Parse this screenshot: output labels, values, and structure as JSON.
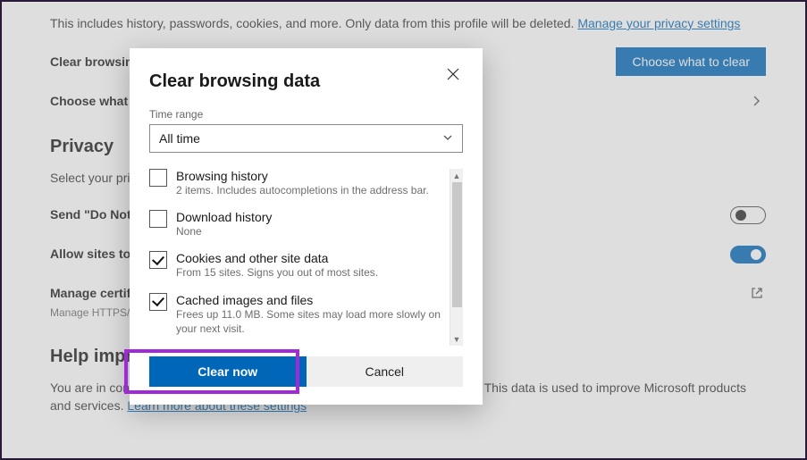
{
  "page": {
    "intro_text": "This includes history, passwords, cookies, and more. Only data from this profile will be deleted. ",
    "intro_link": "Manage your privacy settings",
    "row_clear_label": "Clear browsing data",
    "btn_choose": "Choose what to clear",
    "row_choose_close": "Choose what to clear every time you close the browser",
    "section_privacy": "Privacy",
    "privacy_sub": "Select your privacy settings for Microsoft Edge.",
    "row_dnt": "Send \"Do Not Track\" requests",
    "row_allow_sites": "Allow sites to check if you have payment methods saved",
    "row_certs": "Manage certificates",
    "row_certs_desc": "Manage HTTPS/SSL certificates and settings",
    "section_help": "Help improve Microsoft Edge",
    "help_text_a": "You are in control of your data. Learn about the data you share with Microsoft. This data is used to improve Microsoft products and services. ",
    "help_link": "Learn more about these settings"
  },
  "dialog": {
    "title": "Clear browsing data",
    "time_label": "Time range",
    "time_value": "All time",
    "options": [
      {
        "title": "Browsing history",
        "desc": "2 items. Includes autocompletions in the address bar.",
        "checked": false
      },
      {
        "title": "Download history",
        "desc": "None",
        "checked": false
      },
      {
        "title": "Cookies and other site data",
        "desc": "From 15 sites. Signs you out of most sites.",
        "checked": true
      },
      {
        "title": "Cached images and files",
        "desc": "Frees up 11.0 MB. Some sites may load more slowly on your next visit.",
        "checked": true
      }
    ],
    "clear_btn": "Clear now",
    "cancel_btn": "Cancel"
  },
  "toggles": {
    "dnt": false,
    "allow_sites": true
  }
}
